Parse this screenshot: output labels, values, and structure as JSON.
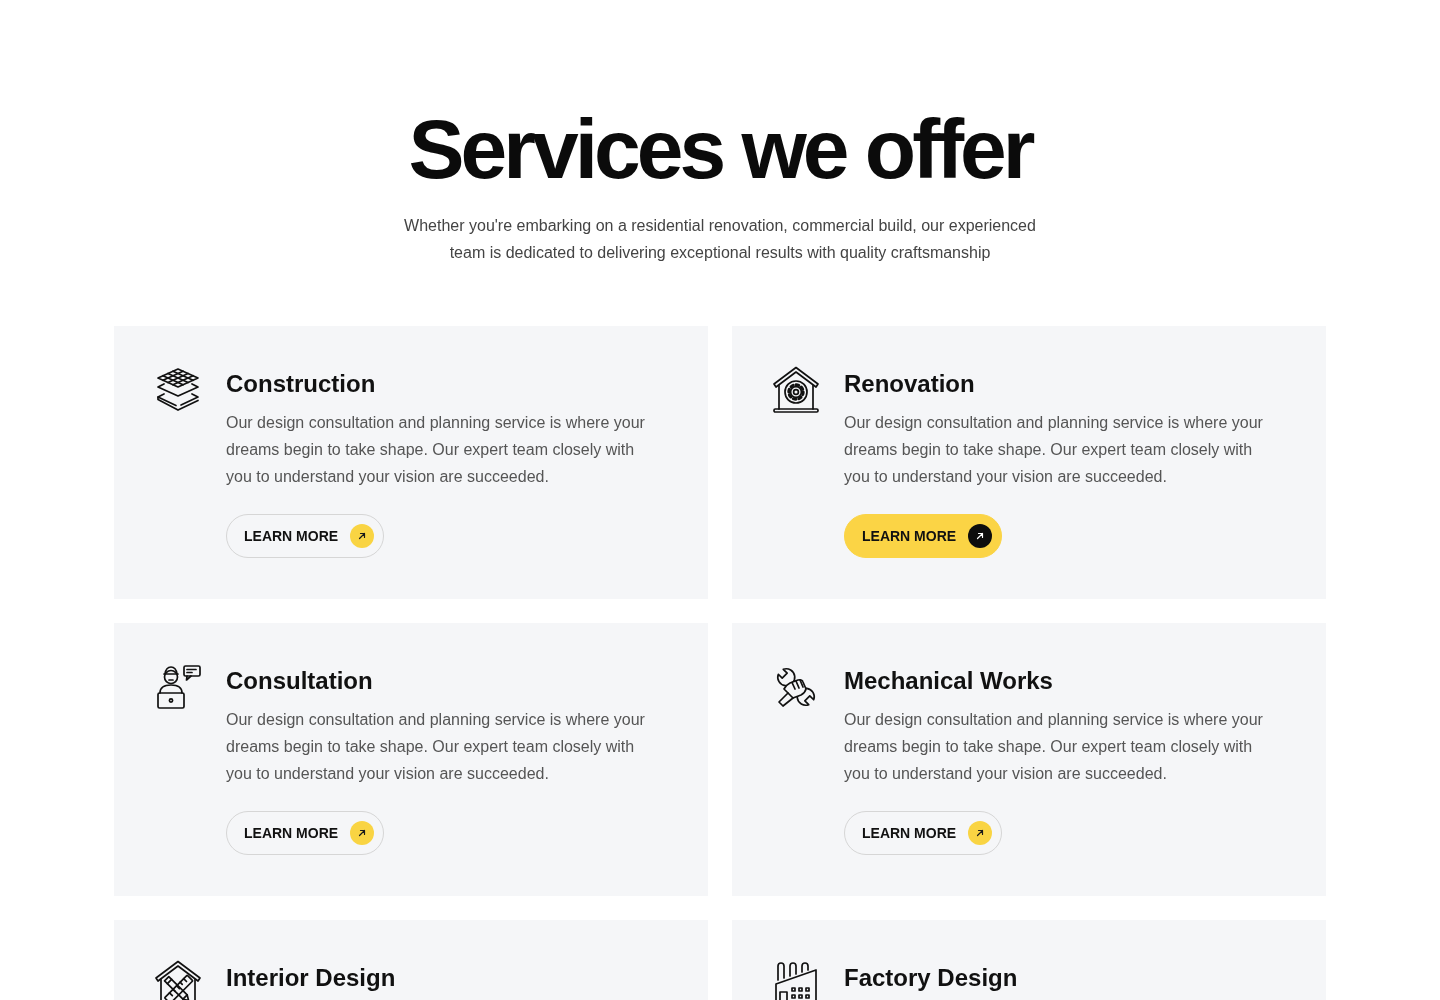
{
  "heading": "Services we offer",
  "subtitle": "Whether you're embarking on a residential renovation, commercial build, our experienced team is dedicated to delivering exceptional results with quality craftsmanship",
  "services": [
    {
      "title": "Construction",
      "description": "Our design consultation and planning service is where your dreams begin to take shape. Our expert team closely with you to understand your vision are succeeded.",
      "button": {
        "label": "LEARN MORE",
        "active": false
      }
    },
    {
      "title": "Renovation",
      "description": "Our design consultation and planning service is where your dreams begin to take shape. Our expert team closely with you to understand your vision are succeeded.",
      "button": {
        "label": "LEARN MORE",
        "active": true
      }
    },
    {
      "title": "Consultation",
      "description": "Our design consultation and planning service is where your dreams begin to take shape. Our expert team closely with you to understand your vision are succeeded.",
      "button": {
        "label": "LEARN MORE",
        "active": false
      }
    },
    {
      "title": "Mechanical Works",
      "description": "Our design consultation and planning service is where your dreams begin to take shape. Our expert team closely with you to understand your vision are succeeded.",
      "button": {
        "label": "LEARN MORE",
        "active": false
      }
    },
    {
      "title": "Interior Design"
    },
    {
      "title": "Factory Design"
    }
  ]
}
